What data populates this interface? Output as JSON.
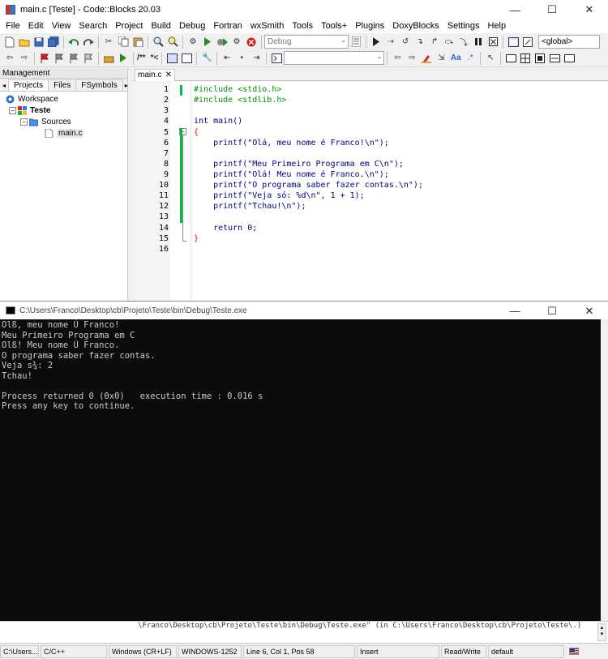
{
  "app": {
    "title": "main.c [Teste] - Code::Blocks 20.03",
    "minimize": "—",
    "maximize": "☐",
    "close": "✕"
  },
  "menu": [
    "File",
    "Edit",
    "View",
    "Search",
    "Project",
    "Build",
    "Debug",
    "Fortran",
    "wxSmith",
    "Tools",
    "Tools+",
    "Plugins",
    "DoxyBlocks",
    "Settings",
    "Help"
  ],
  "toolbar": {
    "build_target": "Debug",
    "scope": "<global>",
    "comment_label": "/**",
    "uncomment_label": "*<"
  },
  "management": {
    "title": "Management",
    "tabs": [
      "Projects",
      "Files",
      "FSymbols"
    ],
    "tree": {
      "workspace": "Workspace",
      "project": "Teste",
      "folder": "Sources",
      "file": "main.c"
    }
  },
  "editor": {
    "tab": "main.c",
    "line_numbers": [
      "1",
      "2",
      "3",
      "4",
      "5",
      "6",
      "7",
      "8",
      "9",
      "10",
      "11",
      "12",
      "13",
      "14",
      "15",
      "16"
    ],
    "lines": [
      "#include <stdio.h>",
      "#include <stdlib.h>",
      "",
      "int main()",
      "{",
      "    printf(\"Olá, meu nome é Franco!\\n\");",
      "",
      "    printf(\"Meu Primeiro Programa em C\\n\");",
      "    printf(\"Olá! Meu nome é Franco.\\n\");",
      "    printf(\"O programa saber fazer contas.\\n\");",
      "    printf(\"Veja só: %d\\n\", 1 + 1);",
      "    printf(\"Tchau!\\n\");",
      "",
      "    return 0;",
      "}",
      ""
    ]
  },
  "console": {
    "title": "C:\\Users\\Franco\\Desktop\\cb\\Projeto\\Teste\\bin\\Debug\\Teste.exe",
    "output": [
      "Olß, meu nome Ú Franco!",
      "Meu Primeiro Programa em C",
      "Olß! Meu nome Ú Franco.",
      "O programa saber fazer contas.",
      "Veja s¾: 2",
      "Tchau!",
      "",
      "Process returned 0 (0x0)   execution time : 0.016 s",
      "Press any key to continue."
    ]
  },
  "log": {
    "text": "\\Franco\\Desktop\\cb\\Projeto\\Teste\\bin\\Debug\\Teste.exe\"  (in C:\\Users\\Franco\\Desktop\\cb\\Projeto\\Teste\\.)"
  },
  "status": {
    "path": "C:\\Users...",
    "language": "C/C++",
    "eol": "Windows (CR+LF)",
    "encoding": "WINDOWS-1252",
    "position": "Line 6, Col 1, Pos 58",
    "mode": "Insert",
    "access": "Read/Write",
    "profile": "default"
  }
}
